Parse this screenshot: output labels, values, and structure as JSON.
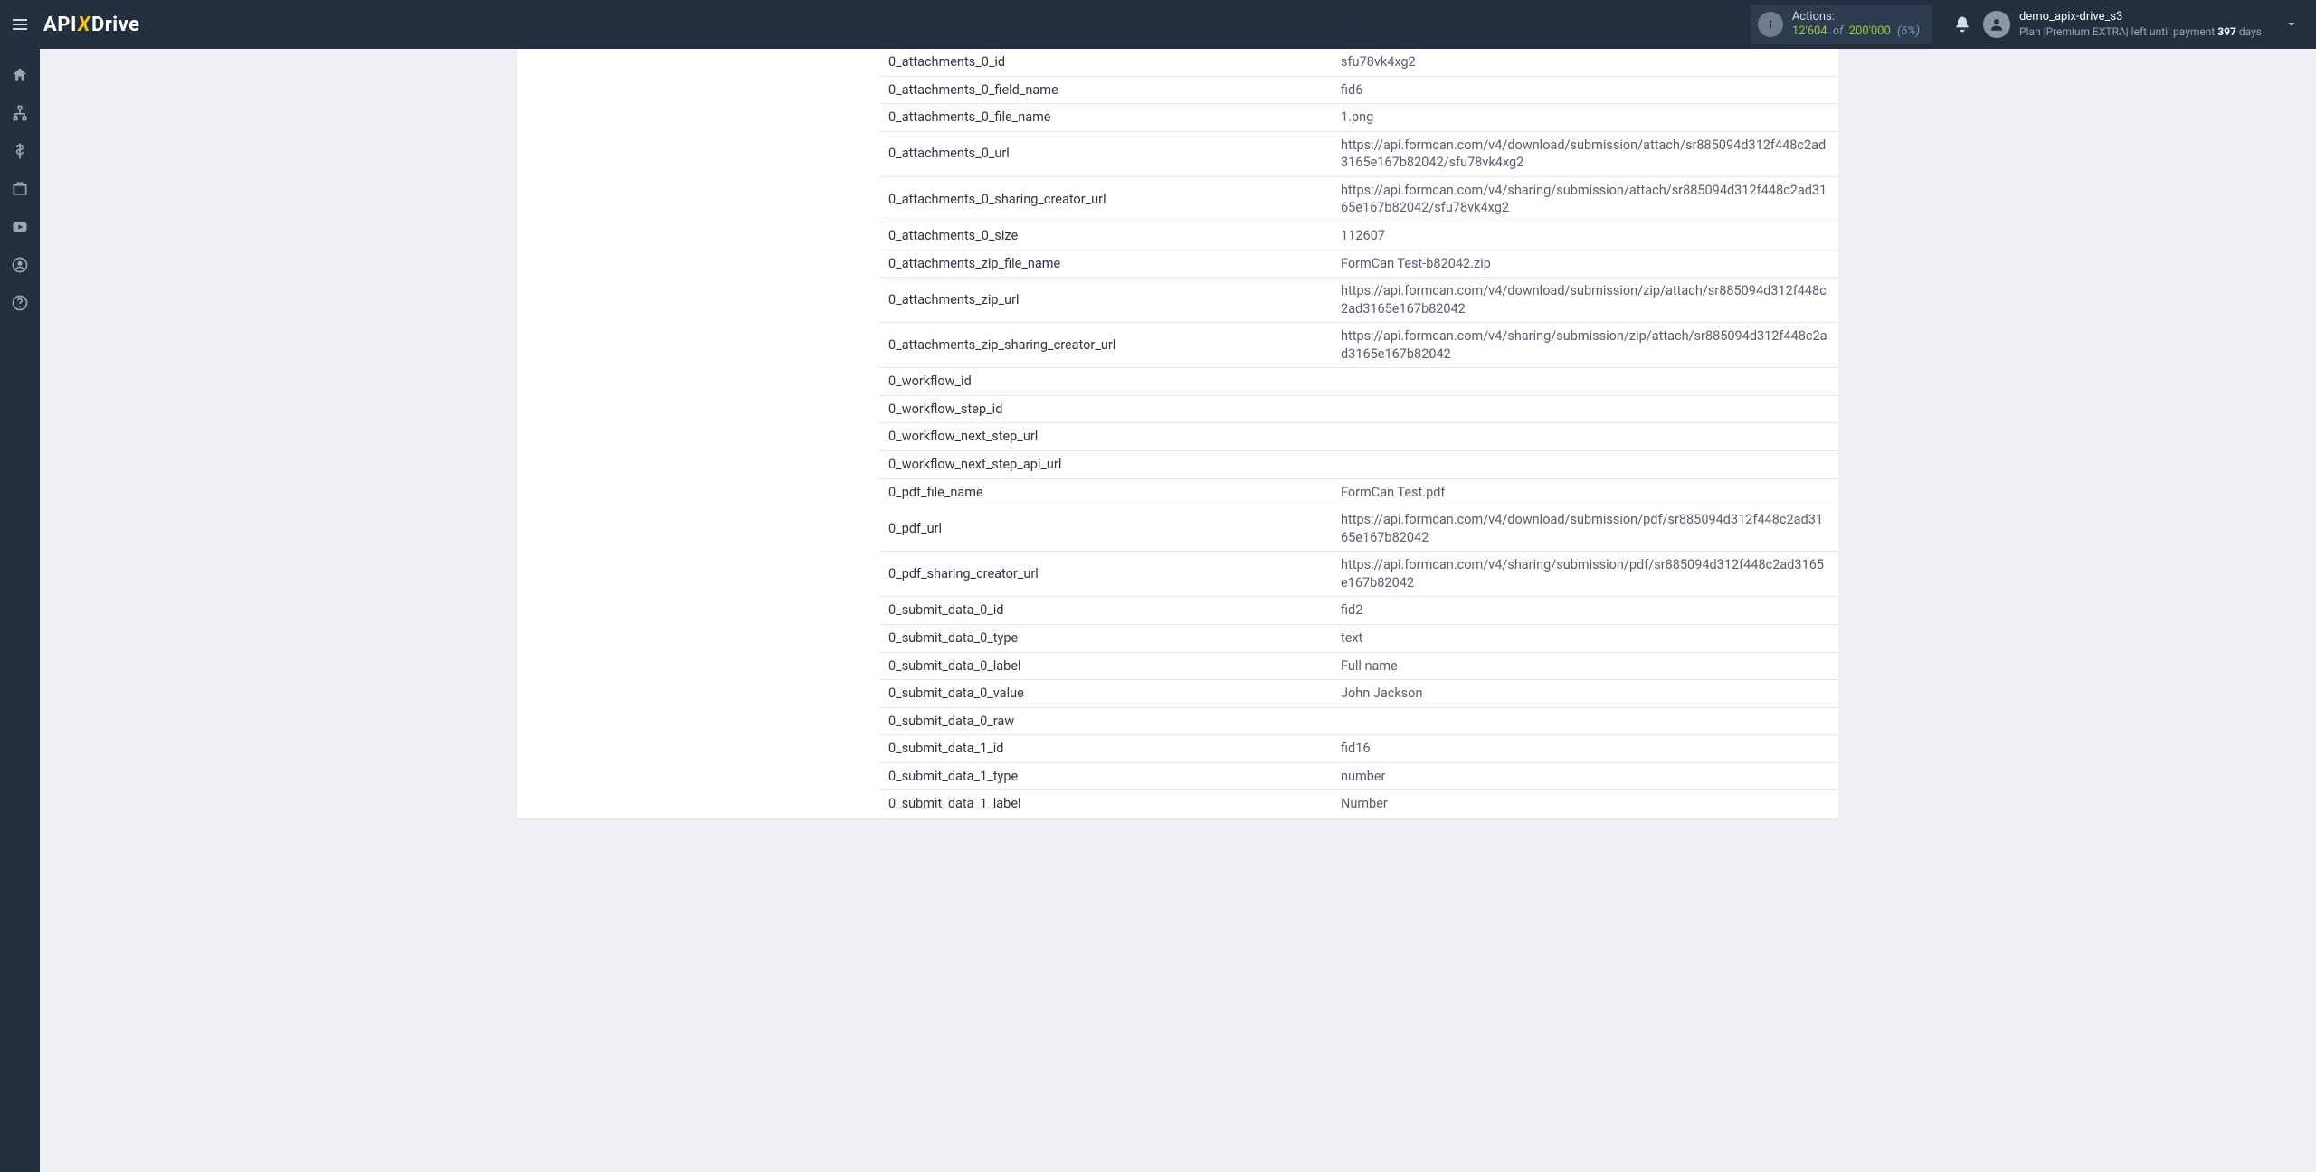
{
  "header": {
    "brand": {
      "api": "API",
      "x": "X",
      "drive": "Drive"
    },
    "actions": {
      "label": "Actions:",
      "used": "12'604",
      "of": "of",
      "limit": "200'000",
      "pct": "(6%)"
    },
    "user": {
      "name": "demo_apix-drive_s3",
      "plan_prefix": "Plan |Premium EXTRA| left until payment ",
      "days": "397",
      "plan_suffix": " days"
    }
  },
  "rows": [
    {
      "key": "0_attachments_0_id",
      "val": "sfu78vk4xg2"
    },
    {
      "key": "0_attachments_0_field_name",
      "val": "fid6"
    },
    {
      "key": "0_attachments_0_file_name",
      "val": "1.png"
    },
    {
      "key": "0_attachments_0_url",
      "val": "https://api.formcan.com/v4/download/submission/attach/sr885094d312f448c2ad3165e167b82042/sfu78vk4xg2"
    },
    {
      "key": "0_attachments_0_sharing_creator_url",
      "val": "https://api.formcan.com/v4/sharing/submission/attach/sr885094d312f448c2ad3165e167b82042/sfu78vk4xg2"
    },
    {
      "key": "0_attachments_0_size",
      "val": "112607"
    },
    {
      "key": "0_attachments_zip_file_name",
      "val": "FormCan Test-b82042.zip"
    },
    {
      "key": "0_attachments_zip_url",
      "val": "https://api.formcan.com/v4/download/submission/zip/attach/sr885094d312f448c2ad3165e167b82042"
    },
    {
      "key": "0_attachments_zip_sharing_creator_url",
      "val": "https://api.formcan.com/v4/sharing/submission/zip/attach/sr885094d312f448c2ad3165e167b82042"
    },
    {
      "key": "0_workflow_id",
      "val": ""
    },
    {
      "key": "0_workflow_step_id",
      "val": ""
    },
    {
      "key": "0_workflow_next_step_url",
      "val": ""
    },
    {
      "key": "0_workflow_next_step_api_url",
      "val": ""
    },
    {
      "key": "0_pdf_file_name",
      "val": "FormCan Test.pdf"
    },
    {
      "key": "0_pdf_url",
      "val": "https://api.formcan.com/v4/download/submission/pdf/sr885094d312f448c2ad3165e167b82042"
    },
    {
      "key": "0_pdf_sharing_creator_url",
      "val": "https://api.formcan.com/v4/sharing/submission/pdf/sr885094d312f448c2ad3165e167b82042"
    },
    {
      "key": "0_submit_data_0_id",
      "val": "fid2"
    },
    {
      "key": "0_submit_data_0_type",
      "val": "text"
    },
    {
      "key": "0_submit_data_0_label",
      "val": "Full name"
    },
    {
      "key": "0_submit_data_0_value",
      "val": "John Jackson"
    },
    {
      "key": "0_submit_data_0_raw",
      "val": ""
    },
    {
      "key": "0_submit_data_1_id",
      "val": "fid16"
    },
    {
      "key": "0_submit_data_1_type",
      "val": "number"
    },
    {
      "key": "0_submit_data_1_label",
      "val": "Number"
    }
  ]
}
